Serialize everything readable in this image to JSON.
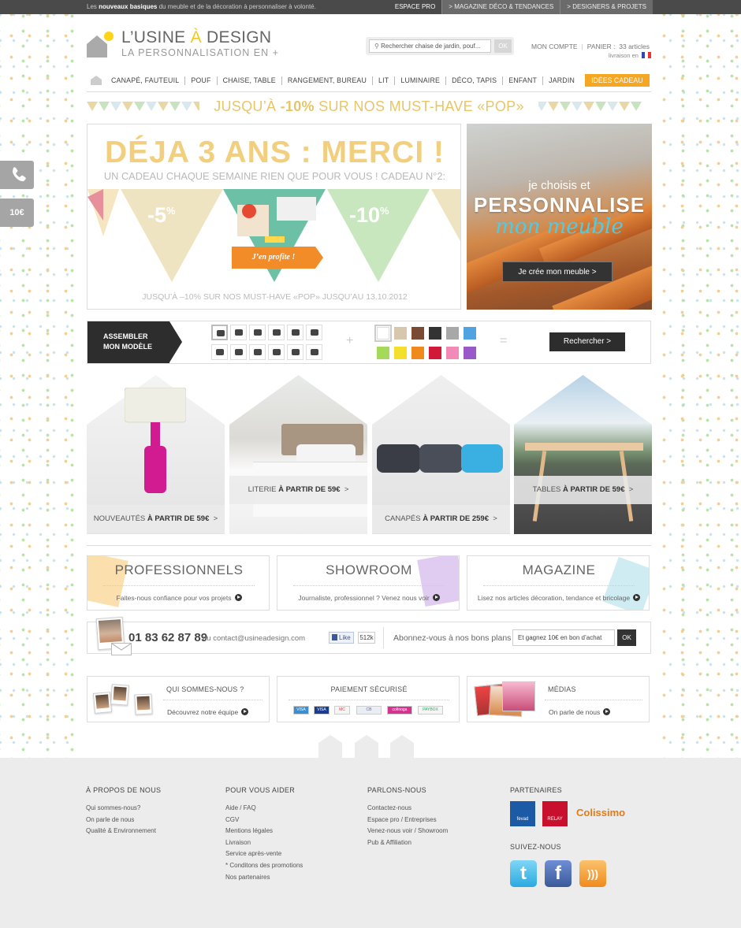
{
  "topbar": {
    "tagline_pre": "Les ",
    "tagline_bold": "nouveaux basiques",
    "tagline_post": " du meuble et de la décoration à personnaliser à volonté.",
    "links": [
      "ESPACE PRO",
      "> MAGAZINE DÉCO & TENDANCES",
      ">  DESIGNERS & PROJETS"
    ]
  },
  "logo": {
    "line1_a": "L’USINE ",
    "line1_accent": "À",
    "line1_b": " DESIGN",
    "line2": "LA PERSONNALISATION EN +"
  },
  "search": {
    "placeholder": "Rechercher chaise de jardin, pouf...",
    "button": "OK"
  },
  "account": {
    "label": "MON COMPTE",
    "cart_label": "PANIER :",
    "cart_count": "33 articles",
    "delivery": "livraison en"
  },
  "nav": {
    "items": [
      "CANAPÉ, FAUTEUIL",
      "POUF",
      "CHAISE, TABLE",
      "RANGEMENT, BUREAU",
      "LIT",
      "LUMINAIRE",
      "DÉCO, TAPIS",
      "ENFANT",
      "JARDIN"
    ],
    "gift": "IDÉES CADEAU"
  },
  "promo": {
    "pre": "JUSQU’À ",
    "bold": "-10%",
    "post": " SUR NOS MUST-HAVE «POP»"
  },
  "hero": {
    "title": "DÉJA 3 ANS : MERCI !",
    "subtitle": "UN CADEAU CHAQUE SEMAINE RIEN QUE POUR VOUS ! CADEAU N°2:",
    "pct1": "-5",
    "pct2": "-10",
    "pct_sign": "%",
    "cta": "J’en profite !",
    "footer": "JUSQU’À –10% SUR NOS MUST-HAVE «POP» JUSQU’AU 13.10.2012"
  },
  "perso": {
    "line1": "je choisis et",
    "line2": "PERSONNALISE",
    "line3": "mon meuble",
    "button": "Je crée mon meuble  >"
  },
  "assembler": {
    "label_line1": "ASSEMBLER",
    "label_line2": "MON MODÈLE",
    "plus": "+",
    "equals": "=",
    "button": "Rechercher  >",
    "swatch_colors": [
      "#ffffff",
      "#d6c7ae",
      "#7a4a32",
      "#333333",
      "#a8a8a8",
      "#4fa3e0",
      "#a6d85a",
      "#f4e02a",
      "#f08a1c",
      "#d11a3a",
      "#f28ab8",
      "#9a59c8"
    ]
  },
  "categories": [
    {
      "name": "NOUVEAUTÉS",
      "price": "À PARTIR DE 59€",
      "arrow": ">"
    },
    {
      "name": "LITERIE",
      "price": "À PARTIR DE 59€",
      "arrow": ">"
    },
    {
      "name": "CANAPÉS",
      "price": "À PARTIR DE 259€",
      "arrow": ">"
    },
    {
      "name": "TABLES",
      "price": "À PARTIR DE 59€",
      "arrow": ">"
    }
  ],
  "boxes": [
    {
      "title": "PROFESSIONNELS",
      "desc": "Faites-nous confiance pour vos projets"
    },
    {
      "title": "SHOWROOM",
      "desc": "Journaliste, professionnel ? Venez nous voir"
    },
    {
      "title": "MAGAZINE",
      "desc": "Lisez nos articles décoration, tendance et bricolage"
    }
  ],
  "contact": {
    "phone": "01 83 62 87 89",
    "email_text": "ou contact@usineadesign.com",
    "like": "Like",
    "like_count": "512k",
    "newsletter": "Abonnez-vous à nos bons plans",
    "newsletter_placeholder": "Et gagnez 10€ en bon d’achat",
    "ok": "OK"
  },
  "lower": [
    {
      "title": "QUI SOMMES-NOUS ?",
      "desc": "Découvrez notre équipe"
    },
    {
      "title": "PAIEMENT SÉCURISÉ",
      "cards": [
        "VISA",
        "VISA",
        "MC",
        "CB",
        "cofinoga",
        "PAYBOX"
      ]
    },
    {
      "title": "MÉDIAS",
      "desc": "On parle de nous"
    }
  ],
  "side": {
    "price_tab": "10€"
  },
  "footer": {
    "col1": {
      "title": "À PROPOS DE NOUS",
      "links": [
        "Qui sommes-nous?",
        "On parle de nous",
        "Qualité & Environnement"
      ]
    },
    "col2": {
      "title": "POUR VOUS AIDER",
      "links": [
        "Aide / FAQ",
        "CGV",
        "Mentions légales",
        "Livraison",
        "Service après-vente",
        "* Conditons des promotions",
        "Nos partenaires"
      ]
    },
    "col3": {
      "title": "PARLONS-NOUS",
      "links": [
        "Contactez-nous",
        "Espace pro / Entreprises",
        "Venez-nous voir / Showroom",
        "Pub & Affiliation"
      ]
    },
    "col4": {
      "title": "PARTENAIRES",
      "partners": [
        "fevad",
        "RELAY",
        "Colissimo"
      ],
      "follow": "SUIVEZ-NOUS"
    }
  }
}
